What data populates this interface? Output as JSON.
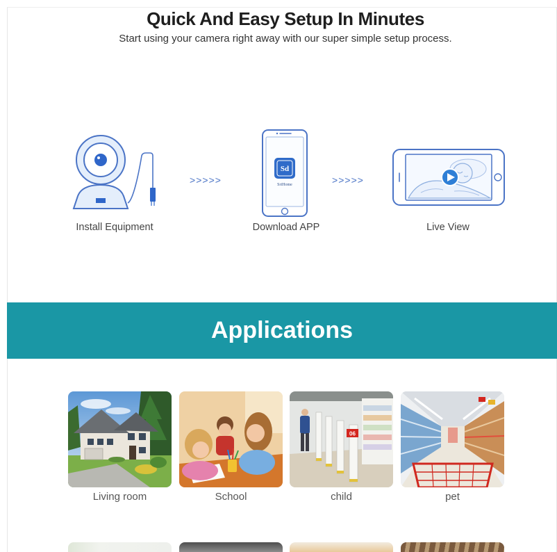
{
  "header": {
    "title": "Quick And Easy Setup In Minutes",
    "subtitle": "Start using your camera right away with our super simple setup process."
  },
  "setup_steps": [
    {
      "label": "Install Equipment",
      "icon": "camera-icon"
    },
    {
      "label": "Download APP",
      "icon": "phone-icon"
    },
    {
      "label": "Live View",
      "icon": "tablet-live-view-icon"
    }
  ],
  "step_arrow": ">>>>>",
  "app": {
    "logo_text": "Sd",
    "name": "SriHome"
  },
  "applications": {
    "title": "Applications",
    "tiles": [
      {
        "label": "Living room",
        "image": "house-photo"
      },
      {
        "label": "School",
        "image": "classroom-photo"
      },
      {
        "label": "child",
        "image": "store-photo",
        "sign_text": "06"
      },
      {
        "label": "pet",
        "image": "supermarket-photo"
      }
    ]
  },
  "colors": {
    "icon_blue": "#4b74c6",
    "band_teal": "#1a97a5",
    "title_text": "#1e1e1e",
    "label_text": "#555555"
  }
}
